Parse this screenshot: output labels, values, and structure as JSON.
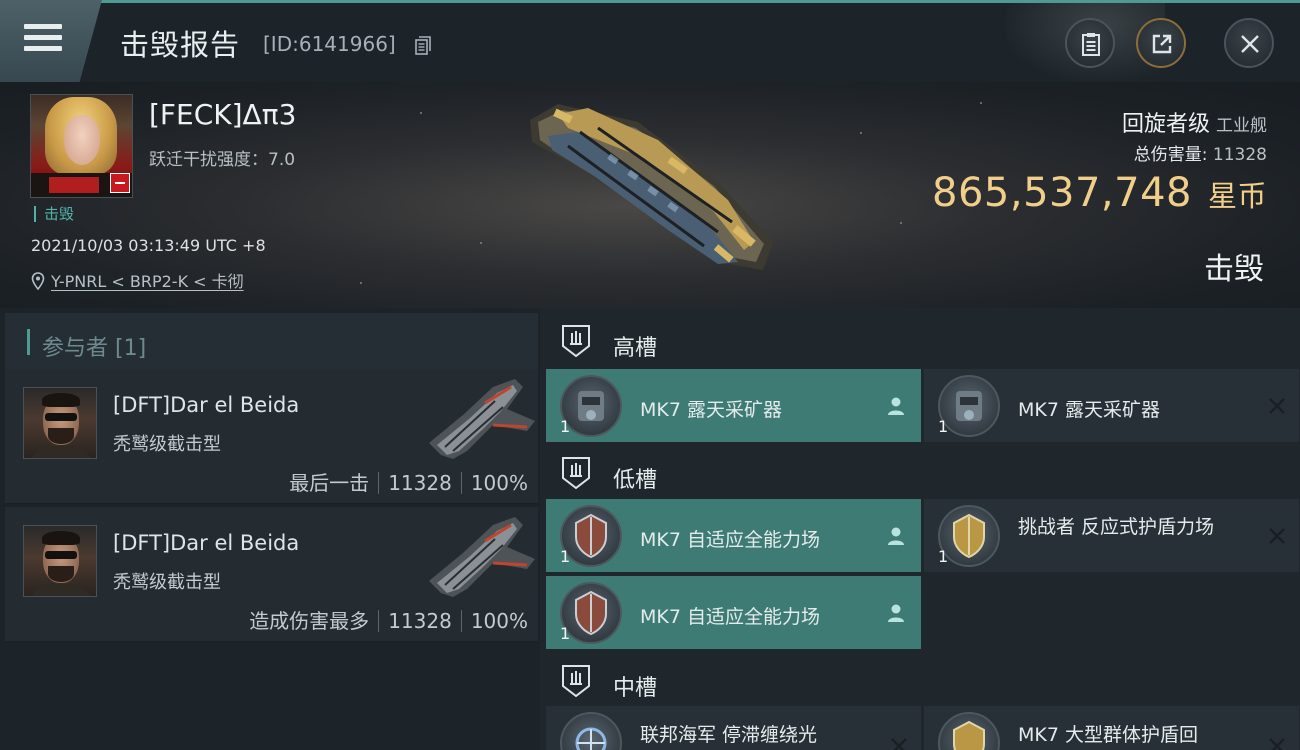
{
  "header": {
    "title": "击毁报告",
    "report_id": "[ID:6141966]",
    "icons": {
      "menu": "hamburger-menu-icon",
      "copy": "copy-icon",
      "clipboard": "clipboard-icon",
      "share": "share-icon",
      "close": "close-icon"
    }
  },
  "victim": {
    "name": "[FECK]Δπ3",
    "warp_strength": "跃迁干扰强度：7.0",
    "status": "击毁",
    "time": "2021/10/03 03:13:49 UTC +8",
    "location": "Y-PNRL < BRP2-K < 卡彻",
    "ship_class": "回旋者级",
    "ship_type": "工业舰",
    "damage_label": "总伤害量:",
    "damage_value": "11328",
    "isk_value": "865,537,748",
    "isk_unit": "星币",
    "result": "击毁"
  },
  "participants": {
    "header": "参与者 [1]",
    "items": [
      {
        "name": "[DFT]Dar el Beida",
        "ship": "秃鹫级截击型",
        "role": "最后一击",
        "damage": "11328",
        "percent": "100%"
      },
      {
        "name": "[DFT]Dar el Beida",
        "ship": "秃鹫级截击型",
        "role": "造成伤害最多",
        "damage": "11328",
        "percent": "100%"
      }
    ]
  },
  "fitting": {
    "high_slot": {
      "label": "高槽",
      "modules": [
        {
          "name": "MK7 露天采矿器",
          "qty": "1",
          "state": "fitted"
        },
        {
          "name": "MK7 露天采矿器",
          "qty": "1",
          "state": "destroyed"
        }
      ]
    },
    "low_slot": {
      "label": "低槽",
      "modules": [
        {
          "name": "MK7 自适应全能力场",
          "qty": "1",
          "state": "fitted"
        },
        {
          "name": "挑战者 反应式护盾力场",
          "qty": "1",
          "state": "destroyed"
        },
        {
          "name": "MK7 自适应全能力场",
          "qty": "1",
          "state": "fitted"
        }
      ]
    },
    "mid_slot": {
      "label": "中槽",
      "modules": [
        {
          "name": "联邦海军 停滞缠绕光",
          "qty": "1",
          "state": "destroyed"
        },
        {
          "name": "MK7 大型群体护盾回",
          "qty": "1",
          "state": "destroyed"
        }
      ]
    }
  },
  "colors": {
    "accent_teal": "#4f9a92",
    "isk_gold": "#f1cf8a",
    "fitted_bg": "#3e7b75"
  }
}
